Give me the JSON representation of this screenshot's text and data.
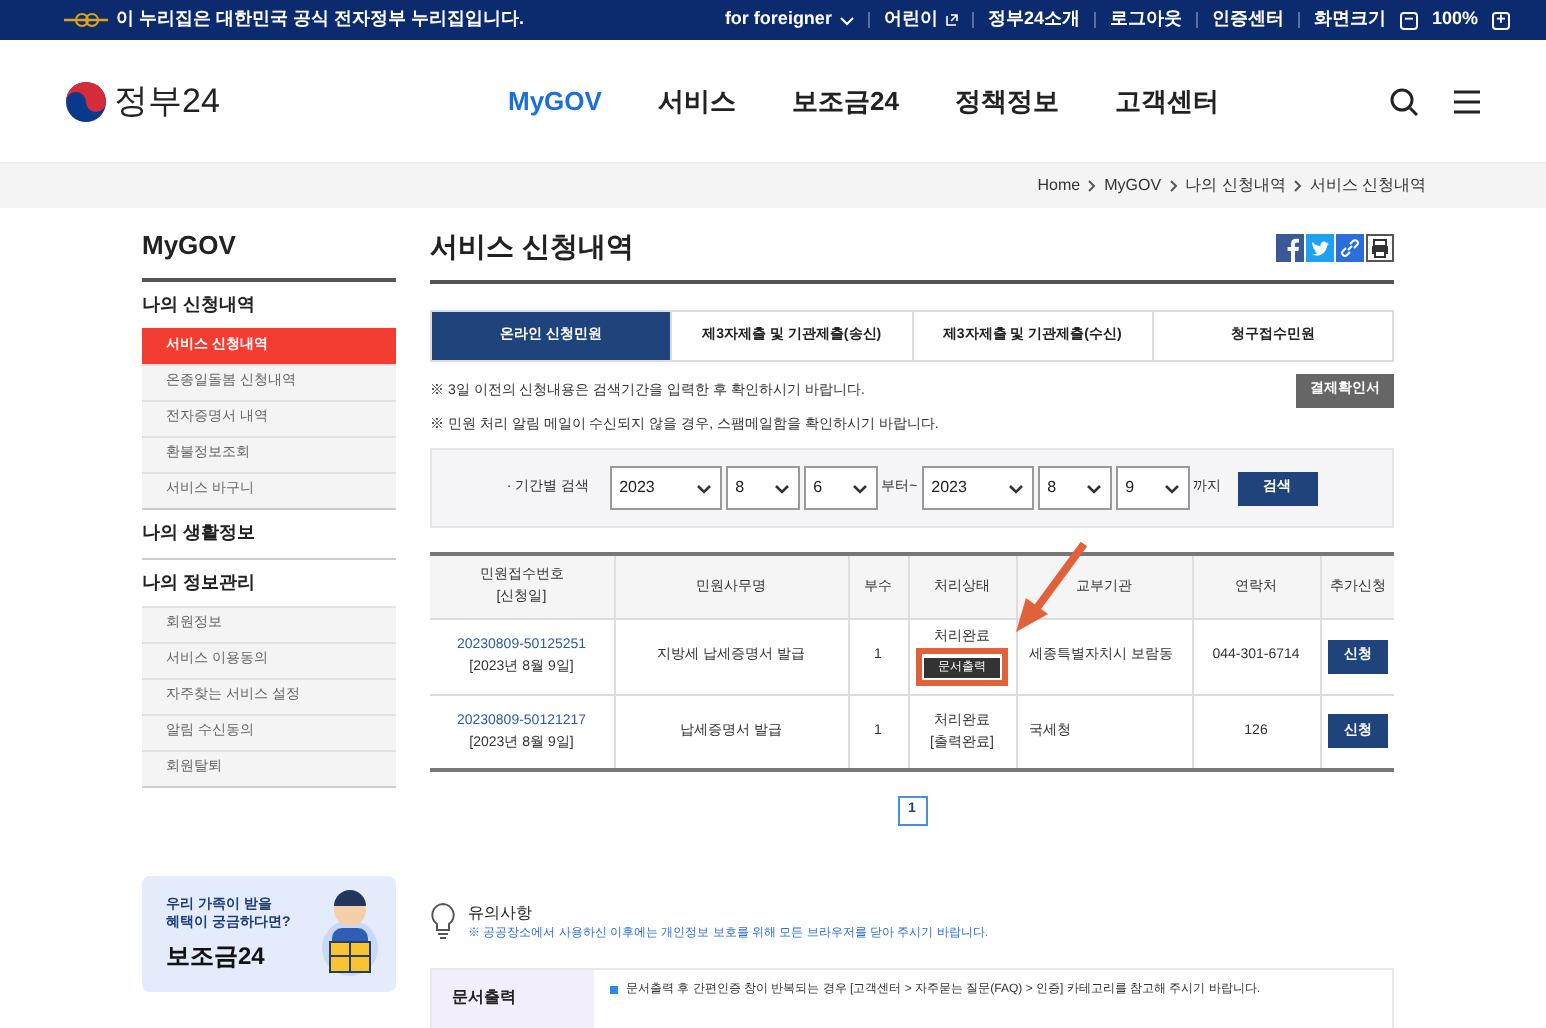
{
  "top_bar": {
    "notice": "이 누리집은 대한민국 공식 전자정부 누리집입니다.",
    "links": [
      {
        "label": "for foreigner",
        "kind": "dropdown"
      },
      {
        "label": "어린이",
        "kind": "external"
      },
      {
        "label": "정부24소개",
        "kind": "plain"
      },
      {
        "label": "로그아웃",
        "kind": "plain"
      },
      {
        "label": "인증센터",
        "kind": "plain"
      }
    ],
    "zoom": {
      "label": "화면크기",
      "minus": "−",
      "value": "100%",
      "plus": "+"
    }
  },
  "header": {
    "logo": "정부24",
    "nav": [
      {
        "label": "MyGOV",
        "selected": true
      },
      {
        "label": "서비스",
        "selected": false
      },
      {
        "label": "보조금24",
        "selected": false
      },
      {
        "label": "정책정보",
        "selected": false
      },
      {
        "label": "고객센터",
        "selected": false
      }
    ]
  },
  "breadcrumb": [
    "Home",
    "MyGOV",
    "나의 신청내역",
    "서비스 신청내역"
  ],
  "sidebar": {
    "title": "MyGOV",
    "sections": [
      {
        "label": "나의 신청내역",
        "items": [
          {
            "label": "서비스 신청내역",
            "selected": true
          },
          {
            "label": "온종일돌봄 신청내역",
            "selected": false
          },
          {
            "label": "전자증명서 내역",
            "selected": false
          },
          {
            "label": "환불정보조회",
            "selected": false
          },
          {
            "label": "서비스 바구니",
            "selected": false
          }
        ]
      },
      {
        "label": "나의 생활정보"
      },
      {
        "label": "나의 정보관리",
        "items": [
          {
            "label": "회원정보",
            "selected": false
          },
          {
            "label": "서비스 이용동의",
            "selected": false
          },
          {
            "label": "자주찾는 서비스 설정",
            "selected": false
          },
          {
            "label": "알림 수신동의",
            "selected": false
          },
          {
            "label": "회원탈퇴",
            "selected": false
          }
        ]
      }
    ],
    "banner": {
      "line_1": "우리 가족이 받을",
      "line_2": "혜택이 궁금하다면?",
      "title": "보조금24"
    }
  },
  "page_title": "서비스 신청내역",
  "tabs": [
    {
      "label": "온라인 신청민원",
      "selected": true
    },
    {
      "label": "제3자제출 및 기관제출(송신)",
      "selected": false
    },
    {
      "label": "제3자제출 및 기관제출(수신)",
      "selected": false
    },
    {
      "label": "청구접수민원",
      "selected": false
    }
  ],
  "notes": [
    "※ 3일 이전의 신청내용은 검색기간을 입력한 후 확인하시기 바랍니다.",
    "※ 민원 처리 알림 메일이 수신되지 않을 경우, 스팸메일함을 확인하시기 바랍니다."
  ],
  "payment_button": "결제확인서",
  "search": {
    "label": "· 기간별 검색",
    "from": [
      "2023",
      "8",
      "6"
    ],
    "from_suffix": "부터~",
    "to": [
      "2023",
      "8",
      "9"
    ],
    "to_suffix": "까지",
    "button": "검색"
  },
  "table": {
    "columns": [
      [
        "민원접수번호",
        "[신청일]"
      ],
      [
        "민원사무명"
      ],
      [
        "부수"
      ],
      [
        "처리상태"
      ],
      [
        "교부기관"
      ],
      [
        "연락처"
      ],
      [
        "추가신청"
      ]
    ],
    "rows": [
      {
        "number": "20230809-50125251",
        "date": "[2023년 8월 9일]",
        "name": "지방세 납세증명서 발급",
        "copies": "1",
        "status": "처리완료",
        "kind": "print",
        "print_button": "문서출력",
        "agency": "세종특별자치시 보람동",
        "contact": "044-301-6714",
        "action": "신청",
        "highlighted": true
      },
      {
        "number": "20230809-50121217",
        "date": "[2023년 8월 9일]",
        "name": "납세증명서 발급",
        "copies": "1",
        "status": "처리완료",
        "kind": "printed",
        "status_note": "[출력완료]",
        "agency": "국세청",
        "contact": "126",
        "action": "신청"
      }
    ]
  },
  "pagination": [
    {
      "label": "1",
      "selected": true
    }
  ],
  "caution": {
    "title": "유의사항",
    "text": "※ 공공장소에서 사용하신 이후에는 개인정보 보호를 위해 모든 브라우저를 닫아 주시기 바랍니다."
  },
  "info_table": [
    {
      "label": "문서출력",
      "text": "문서출력 후 간편인증 창이 반복되는 경우 [고객센터 > 자주묻는 질문(FAQ) > 인증] 카테고리를 참고해 주시기 바랍니다."
    }
  ]
}
